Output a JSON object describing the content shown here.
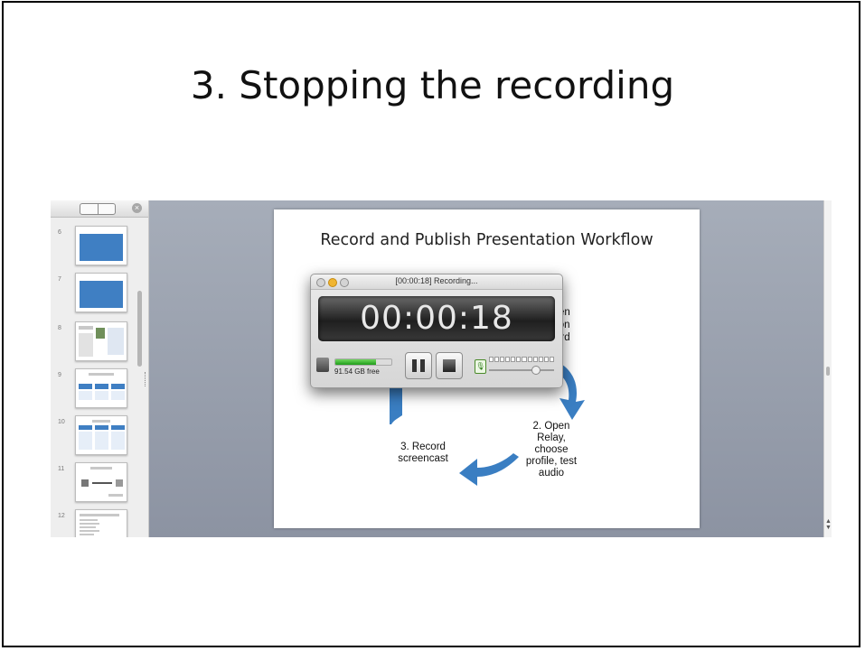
{
  "page": {
    "title": "3. Stopping the recording"
  },
  "thumbnails": {
    "numbers": [
      "6",
      "7",
      "8",
      "9",
      "10",
      "11",
      "12"
    ],
    "close_glyph": "×"
  },
  "slide": {
    "title": "Record and Publish Presentation Workflow",
    "step2": [
      "2. Open",
      "Relay,",
      "choose",
      "profile, test",
      "audio"
    ],
    "step3": [
      "3. Record",
      "screencast"
    ],
    "step1_partial": [
      "en",
      "tion",
      "ord"
    ]
  },
  "recorder": {
    "title": "[00:00:18] Recording...",
    "timer": "00:00:18",
    "disk_free": "91.54 GB free",
    "disk_fill_fraction": 0.72,
    "mic_glyph": "🎙",
    "meter_segments": 12
  },
  "colors": {
    "arrow_blue": "#3a7ec2",
    "canvas_gray": "#9aa1ae",
    "meter_green": "#34b024"
  },
  "icons": [
    "close-icon",
    "view-toggle-icon",
    "pause-icon",
    "stop-icon",
    "microphone-icon",
    "disk-icon"
  ]
}
